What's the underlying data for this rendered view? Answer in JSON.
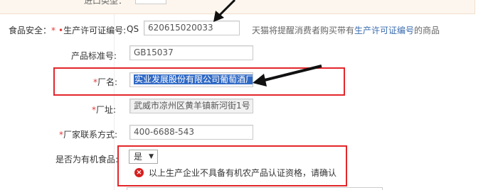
{
  "top": {
    "label": "进口类型："
  },
  "food_safety": {
    "section_label": "食品安全：",
    "license": {
      "label": "生产许可证编号:",
      "prefix": "QS",
      "value": "620615020033",
      "hint_text": "天猫将提醒消费者购买带有",
      "hint_link": "生产许可证编号",
      "hint_suffix": "的商品"
    },
    "standard": {
      "label": "产品标准号:",
      "value": "GB15037"
    },
    "factory_name": {
      "label": "厂名:",
      "value": "实业发展股份有限公司葡萄酒厂"
    },
    "factory_address": {
      "label": "厂址:",
      "value": "武威市凉州区黄羊镇新河街1号"
    },
    "contact": {
      "label": "厂家联系方式:",
      "value": "400-6688-543"
    },
    "organic": {
      "label": "是否为有机食品:",
      "selected": "是",
      "error": "以上生产企业不具备有机农产品认证资格，请确认"
    }
  },
  "colors": {
    "required": "#e4393c",
    "highlight_box": "#e3262b",
    "selection": "#316ac5",
    "error_icon": "#d81e1e",
    "link": "#3a6cae"
  },
  "icons": {
    "required_marker": "asterisk",
    "error": "error-circle-icon",
    "annotation": "arrow-pointer-icon",
    "dropdown": "caret-down-icon"
  }
}
